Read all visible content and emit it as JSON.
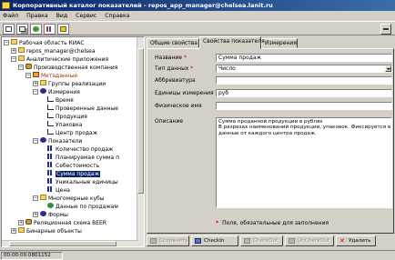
{
  "window": {
    "title": "Корпоративный каталог показателей - repos_app_manager@chelsea.lanit.ru"
  },
  "menu": [
    "Файл",
    "Правка",
    "Вид",
    "Сервис",
    "Справка"
  ],
  "toolbar": {
    "buttons": [
      "new-document-icon",
      "copy-icon",
      "refresh-icon",
      "chart-icon",
      "properties-icon"
    ]
  },
  "tree": [
    {
      "label": "Рабочая область КИАС",
      "icon": "workspace-icon",
      "expander": "-"
    },
    {
      "label": "repos_manager@chelsea",
      "icon": "folder-icon",
      "expander": "+"
    },
    {
      "label": "Аналитические приложения",
      "icon": "folder-icon",
      "expander": "-"
    },
    {
      "label": "Производственная компания",
      "icon": "database-icon",
      "expander": "-"
    },
    {
      "label": "Метаданные",
      "icon": "metadata-icon",
      "expander": "-"
    },
    {
      "label": "Группы реализации",
      "icon": "cube-icon",
      "expander": "+"
    },
    {
      "label": "Измерения",
      "icon": "dimensions-icon",
      "expander": "-"
    },
    {
      "label": "Время",
      "icon": "dimension-icon"
    },
    {
      "label": "Проверенные данные",
      "icon": "dimension-icon"
    },
    {
      "label": "Продукция",
      "icon": "dimension-icon"
    },
    {
      "label": "Упаковка",
      "icon": "dimension-icon"
    },
    {
      "label": "Центр продаж",
      "icon": "dimension-icon"
    },
    {
      "label": "Показатели",
      "icon": "measures-icon",
      "expander": "-"
    },
    {
      "label": "Количество продаж",
      "icon": "measure-icon"
    },
    {
      "label": "Планируемая сумма п",
      "icon": "measure-icon"
    },
    {
      "label": "Себестоимость",
      "icon": "measure-icon"
    },
    {
      "label": "Сумма продаж",
      "icon": "measure-icon",
      "selected": true
    },
    {
      "label": "Уникальные единицы",
      "icon": "measure-icon"
    },
    {
      "label": "Цена",
      "icon": "measure-icon"
    },
    {
      "label": "Многомерные кубы",
      "icon": "cube-icon",
      "expander": "-"
    },
    {
      "label": "Данные по продажам",
      "icon": "globe-icon"
    },
    {
      "label": "Формы",
      "icon": "forms-icon",
      "expander": "+"
    },
    {
      "label": "Реляционная схема BEER",
      "icon": "database-icon",
      "expander": "+"
    },
    {
      "label": "Бинарные объекты",
      "icon": "folder-icon",
      "expander": "+"
    }
  ],
  "tabs": [
    "Общие свойства",
    "Свойства показателя",
    "Измерения"
  ],
  "active_tab": "Свойства показателя",
  "form": {
    "name_label": "Название",
    "name_value": "Сумма продаж",
    "type_label": "Тип данных",
    "type_value": "Число",
    "abbr_label": "Аббревиатура",
    "abbr_value": "",
    "unit_label": "Единицы измерения",
    "unit_value": "руб",
    "physname_label": "Физическое имя",
    "physname_value": "",
    "desc_label": "Описание",
    "desc_lines": [
      "Сумма проданной продукции в рублях",
      "В разрезах наименований продукции, упаковок. Фиксируется еже",
      "данные от каждого центра продаж."
    ],
    "required_mark": "*",
    "required_note": "Поля, обязательные для заполнения"
  },
  "buttons": {
    "save": "Сохранить",
    "checkin": "CheckIn",
    "checkout": "CheckOut",
    "undo_checkout": "UnCheckOut",
    "delete": "Удалить"
  },
  "status": {
    "text": "00:00:00.0801152"
  },
  "colors": {
    "title_start": "#0a246a",
    "title_end": "#3a6ea5",
    "selection": "#0a246a",
    "required": "#d00000"
  }
}
